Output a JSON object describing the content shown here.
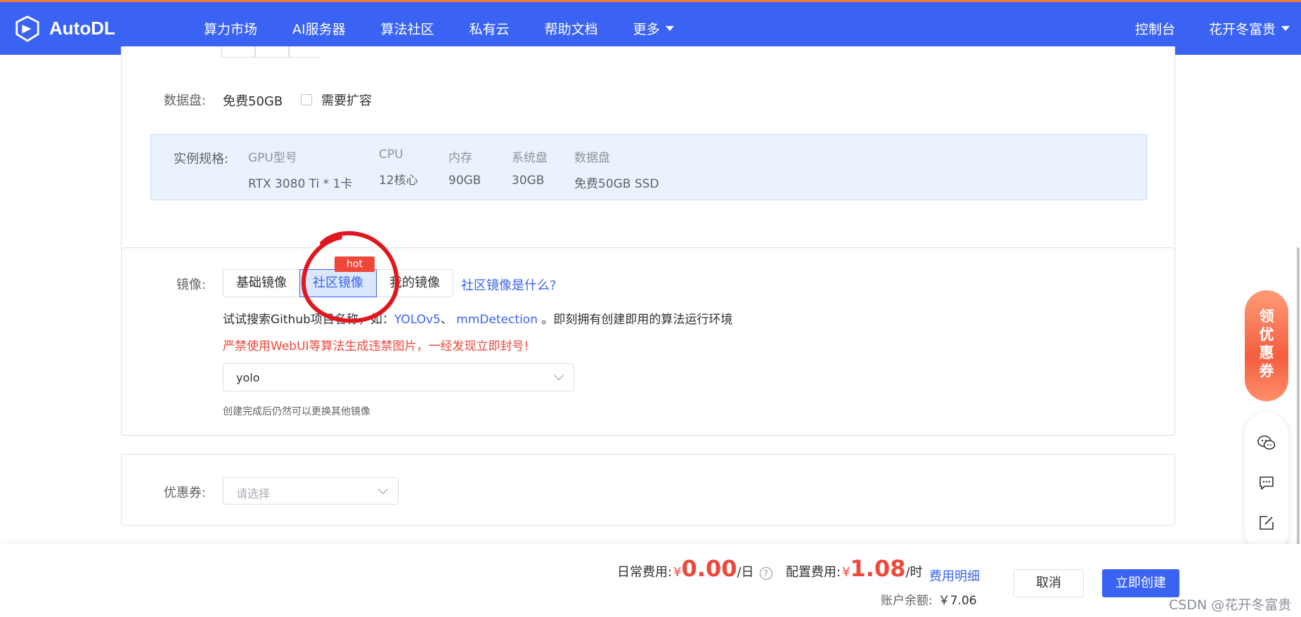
{
  "header": {
    "brand": "AutoDL",
    "nav": [
      "算力市场",
      "AI服务器",
      "算法社区",
      "私有云",
      "帮助文档",
      "更多"
    ],
    "console": "控制台",
    "user": "花开冬富贵"
  },
  "instance": {
    "data_disk_label": "数据盘:",
    "data_disk_value": "免费50GB",
    "expand_label": "需要扩容",
    "spec_label": "实例规格:",
    "spec_headers": [
      "GPU型号",
      "CPU",
      "内存",
      "系统盘",
      "数据盘"
    ],
    "spec_values": [
      "RTX 3080 Ti * 1卡",
      "12核心",
      "90GB",
      "30GB",
      "免费50GB SSD"
    ]
  },
  "image": {
    "label": "镜像:",
    "tabs": [
      "基础镜像",
      "社区镜像",
      "我的镜像"
    ],
    "active_tab": "社区镜像",
    "hot_badge": "hot",
    "help_link": "社区镜像是什么?",
    "hint_prefix": "试试搜索Github项目名称，如：",
    "hint_link1": "YOLOv5",
    "hint_sep": "、 ",
    "hint_link2": "mmDetection",
    "hint_suffix": " 。即刻拥有创建即用的算法运行环境",
    "warning": "严禁使用WebUI等算法生成违禁图片，一经发现立即封号!",
    "select_value": "yolo",
    "note": "创建完成后仍然可以更换其他镜像"
  },
  "coupon": {
    "label": "优惠券:",
    "placeholder": "请选择"
  },
  "sidebar": {
    "promo": [
      "领",
      "优",
      "惠",
      "券"
    ],
    "icons": [
      "wechat-icon",
      "message-icon",
      "edit-icon"
    ]
  },
  "footer": {
    "daily_label": "日常费用:",
    "daily_currency": "¥",
    "daily_amount": "0.00",
    "daily_unit": "/日",
    "help_mark": "?",
    "config_label": "配置费用:",
    "config_currency": "¥",
    "config_amount": "1.08",
    "config_unit": "/时",
    "detail_link": "费用明细",
    "balance_label": "账户余额:",
    "balance_value": "￥7.06",
    "cancel": "取消",
    "create": "立即创建"
  },
  "watermark": "CSDN @花开冬富贵",
  "colors": {
    "primary": "#3a63f3",
    "danger": "#f1463a",
    "spec_bg": "#eaf3fd"
  }
}
